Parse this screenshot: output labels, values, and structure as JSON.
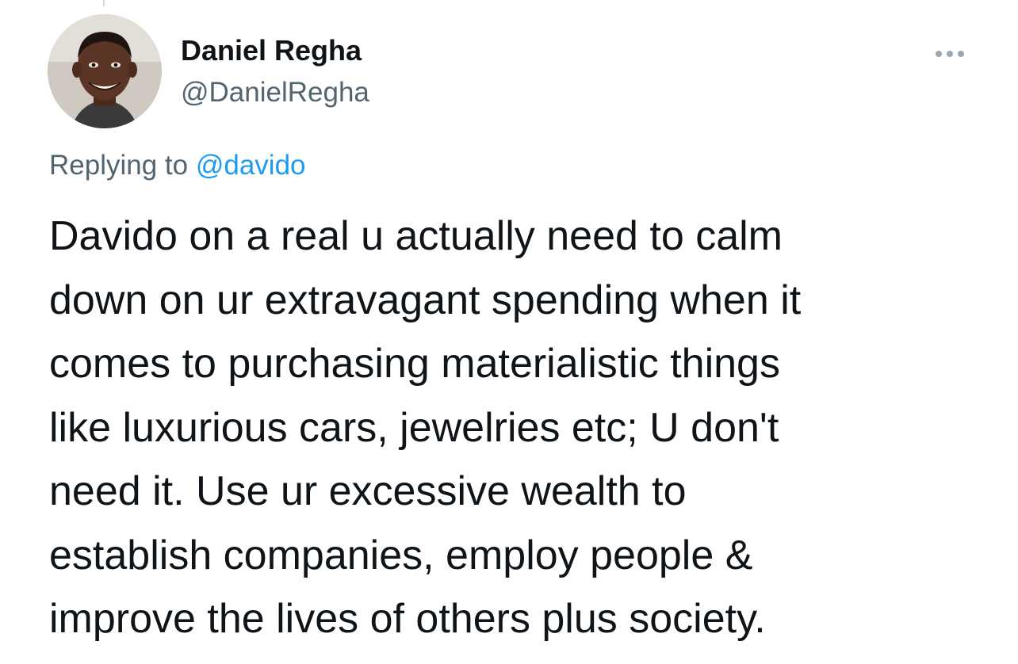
{
  "author": {
    "display_name": "Daniel Regha",
    "handle": "@DanielRegha"
  },
  "reply": {
    "prefix": "Replying to ",
    "target": "@davido"
  },
  "tweet": {
    "lines": [
      "Davido on a real u actually need to calm",
      "down on ur extravagant spending when it",
      "comes to purchasing materialistic things",
      "like luxurious cars, jewelries etc; U don't",
      "need it. Use ur excessive wealth to",
      "establish companies, employ people &",
      "improve the lives of others plus society."
    ]
  },
  "icons": {
    "more": "more-horizontal-icon"
  },
  "colors": {
    "text_primary": "#0f1419",
    "text_secondary": "#536471",
    "link": "#1d9bf0",
    "more_dots": "#9aa7b2"
  }
}
